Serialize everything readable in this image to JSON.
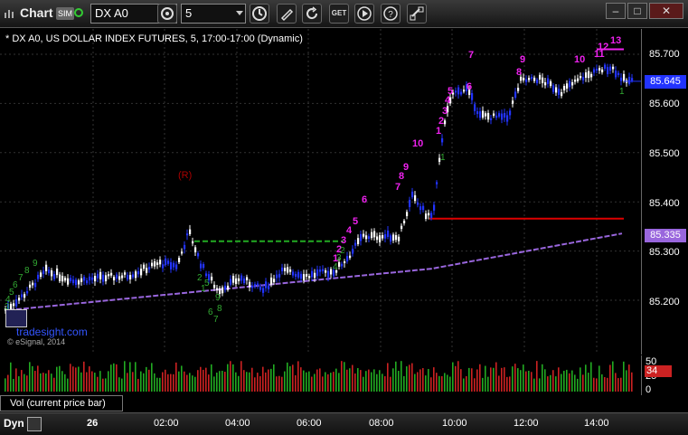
{
  "window": {
    "title": "Chart",
    "sim_badge": "SIM",
    "symbol": "DX A0",
    "interval": "5"
  },
  "chart": {
    "description": "* DX A0, US DOLLAR INDEX FUTURES, 5, 17:00-17:00 (Dynamic)",
    "watermark": "tradesight.com",
    "copyright": "© eSignal, 2014",
    "marker_r": "(R)"
  },
  "price_axis": {
    "ticks": [
      "85.700",
      "85.600",
      "85.500",
      "85.400",
      "85.300",
      "85.200"
    ],
    "last_price": "85.645",
    "ma_price": "85.335"
  },
  "volume": {
    "ticks": [
      "50",
      "25",
      "0"
    ],
    "current": "34",
    "legend": "Vol (current price bar)"
  },
  "time_axis": {
    "ticks": [
      "26",
      "02:00",
      "04:00",
      "06:00",
      "08:00",
      "10:00",
      "12:00",
      "14:00"
    ]
  },
  "bottom_bar": {
    "label": "Dyn"
  },
  "counts": {
    "magenta": [
      "7",
      "9",
      "8",
      "10",
      "11",
      "12",
      "13",
      "6",
      "5",
      "4",
      "3",
      "2",
      "1",
      "10",
      "9",
      "8",
      "7",
      "6",
      "5",
      "4",
      "3",
      "2",
      "1"
    ],
    "green": [
      "9",
      "8",
      "7",
      "6",
      "5",
      "4",
      "3",
      "2",
      "1",
      "9",
      "8",
      "7",
      "6",
      "5",
      "4",
      "3",
      "2",
      "1",
      "1"
    ]
  },
  "colors": {
    "up": "#ffffff",
    "down": "#2233ff",
    "ma": "#9966dd",
    "support": "#dd0000",
    "resistance": "#22aa22",
    "magenta": "#ee22ee",
    "green": "#33aa33",
    "vol_up": "#22aa22",
    "vol_down": "#cc2222"
  }
}
